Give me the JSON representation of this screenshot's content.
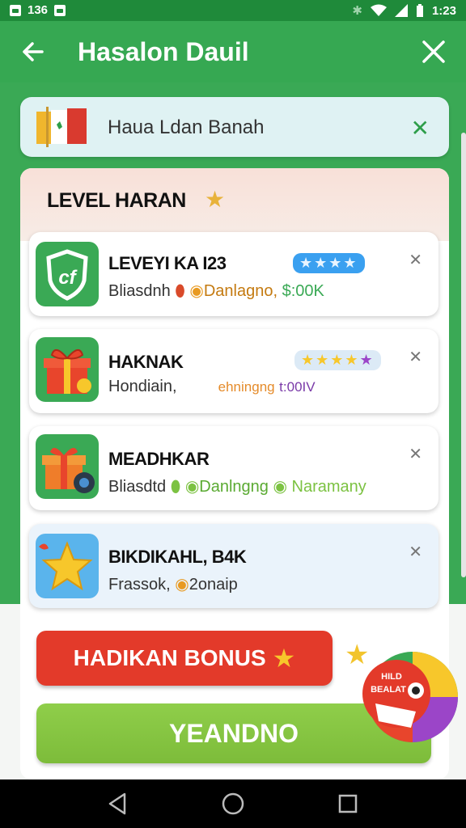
{
  "status_bar": {
    "left_text": "136",
    "time": "1:23"
  },
  "app_bar": {
    "title": "Hasalon Dauil"
  },
  "banner": {
    "text": "Haua Ldan Banah"
  },
  "panel": {
    "title": "LEVEL HARAN"
  },
  "cards": [
    {
      "title": "LEVEYI KA I23",
      "sub1": "Bliasdnh",
      "sub2": "Danlagno,",
      "sub3": "$:00K",
      "stars": "★★★★"
    },
    {
      "title": "HAKNAK",
      "sub1": "Hondiain,",
      "sub2": "ehningng",
      "sub3": "t:00IV",
      "stars": "★★★★★"
    },
    {
      "title": "MEADHKAR",
      "sub1": "Bliasdtd",
      "sub2": "Danlngng",
      "sub3": "Naramany"
    },
    {
      "title": "BIKDIKAHL, B4K",
      "sub1": "Frassok,",
      "sub2": "2onaip"
    }
  ],
  "buttons": {
    "bonus": "HADIKAN BONUS",
    "yes": "YEANDNO"
  },
  "badge": {
    "text_line1": "HILD",
    "text_line2": "BEALAT"
  },
  "colors": {
    "primary_green": "#36a852",
    "bonus_red": "#e33a2a",
    "yes_green": "#8fce4a",
    "star_yellow": "#f7c72b"
  }
}
